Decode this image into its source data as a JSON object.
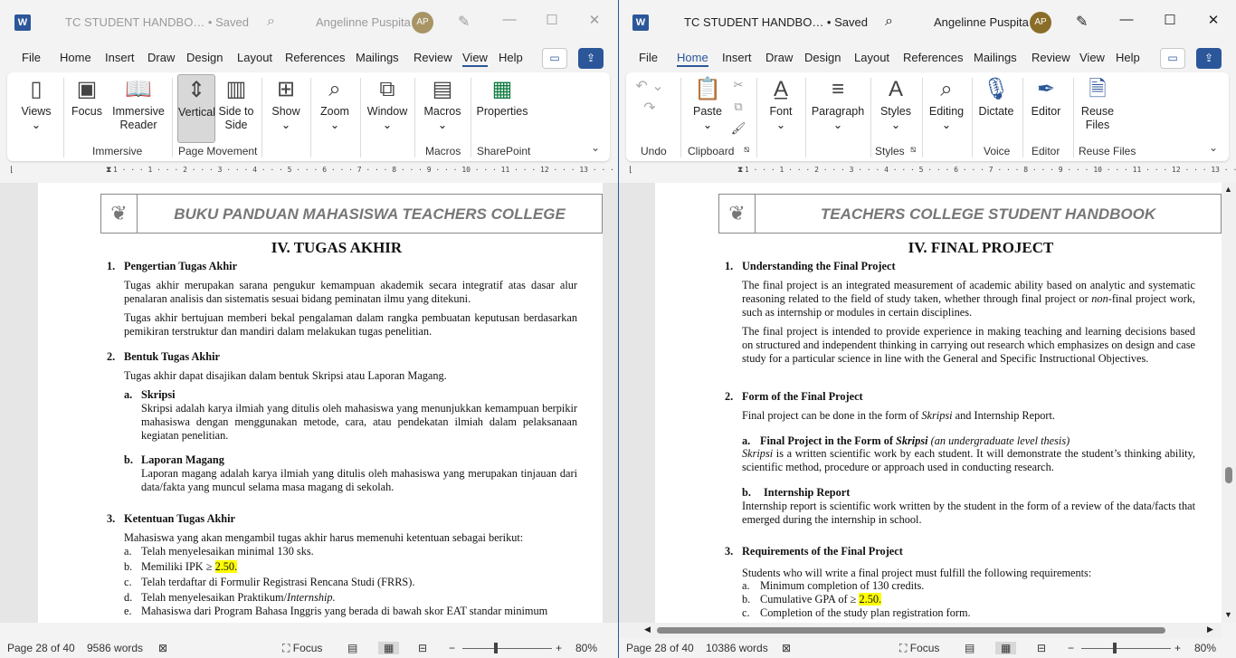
{
  "left": {
    "doc_title": "TC STUDENT HANDBO… • Saved",
    "user": "Angelinne Puspita",
    "initials": "AP",
    "menus": [
      "File",
      "Home",
      "Insert",
      "Draw",
      "Design",
      "Layout",
      "References",
      "Mailings",
      "Review",
      "View",
      "Help"
    ],
    "active_menu": "View",
    "ribbon": {
      "views": "Views",
      "focus": "Focus",
      "immersive_reader": "Immersive Reader",
      "vertical": "Vertical",
      "side_to_side": "Side to Side",
      "show": "Show",
      "zoom": "Zoom",
      "window": "Window",
      "macros": "Macros",
      "properties": "Properties",
      "groups": [
        "Immersive",
        "Page Movement",
        "Macros",
        "SharePoint"
      ]
    },
    "ruler": "1 · · · 1 · · · 2 · · · 3 · · · 4 · · · 5 · · · 6 · · · 7 · · · 8 · · · 9 · · · 10 · · · 11 · · · 12 · · · 13 · · · 14 · · · 15 · · · 16",
    "header_title": "BUKU PANDUAN MAHASISWA TEACHERS COLLEGE",
    "chapter": "IV. TUGAS AKHIR",
    "s1_num": "1.",
    "s1_title": "Pengertian Tugas Akhir",
    "s1_p1": "Tugas akhir merupakan sarana pengukur kemampuan akademik secara integratif atas dasar alur penalaran analisis dan sistematis sesuai bidang peminatan ilmu yang ditekuni.",
    "s1_p2": "Tugas akhir bertujuan memberi bekal pengalaman dalam rangka pembuatan keputusan berdasarkan pemikiran terstruktur dan mandiri dalam melakukan tugas penelitian.",
    "s2_num": "2.",
    "s2_title": "Bentuk Tugas Akhir",
    "s2_p": "Tugas akhir dapat disajikan dalam bentuk Skripsi atau Laporan Magang.",
    "s2a_label": "a.",
    "s2a_title": "Skripsi",
    "s2a_p": "Skripsi adalah karya ilmiah yang ditulis oleh mahasiswa yang menunjukkan kemampuan berpikir mahasiswa dengan menggunakan metode, cara, atau pendekatan ilmiah dalam pelaksanaan kegiatan penelitian.",
    "s2b_label": "b.",
    "s2b_title": "Laporan Magang",
    "s2b_p": "Laporan magang adalah karya ilmiah yang ditulis oleh mahasiswa yang merupakan tinjauan dari data/fakta yang muncul selama masa magang di sekolah.",
    "s3_num": "3.",
    "s3_title": "Ketentuan Tugas Akhir",
    "s3_p": "Mahasiswa yang akan mengambil tugas akhir harus memenuhi ketentuan sebagai berikut:",
    "s3_items": [
      {
        "l": "a.",
        "t": "Telah menyelesaikan minimal 130 sks."
      },
      {
        "l": "b.",
        "t": "Memiliki IPK ≥ ",
        "h": "2.50."
      },
      {
        "l": "c.",
        "t": "Telah terdaftar di Formulir Registrasi Rencana Studi (FRRS)."
      },
      {
        "l": "d.",
        "t": "Telah menyelesaikan Praktikum/",
        "it": "Internship."
      },
      {
        "l": "e.",
        "t": "Mahasiswa dari Program Bahasa Inggris yang berada di bawah skor EAT standar minimum"
      }
    ],
    "status_page": "Page 28 of 40",
    "status_words": "9586 words",
    "status_focus": "Focus",
    "zoom": "80%"
  },
  "right": {
    "doc_title": "TC STUDENT HANDBO… • Saved",
    "user": "Angelinne Puspita",
    "initials": "AP",
    "menus": [
      "File",
      "Home",
      "Insert",
      "Draw",
      "Design",
      "Layout",
      "References",
      "Mailings",
      "Review",
      "View",
      "Help"
    ],
    "active_menu": "Home",
    "ribbon": {
      "paste": "Paste",
      "font": "Font",
      "paragraph": "Paragraph",
      "styles": "Styles",
      "editing": "Editing",
      "dictate": "Dictate",
      "editor": "Editor",
      "reuse_files": "Reuse Files",
      "groups": [
        "Undo",
        "Clipboard",
        "Styles",
        "Voice",
        "Editor",
        "Reuse Files"
      ]
    },
    "ruler": "1 · · · 1 · · · 2 · · · 3 · · · 4 · · · 5 · · · 6 · · · 7 · · · 8 · · · 9 · · · 10 · · · 11 · · · 12 · · · 13 · · · 14 · · · 15 · · · 16",
    "header_title": "TEACHERS COLLEGE STUDENT HANDBOOK",
    "chapter": "IV. FINAL PROJECT",
    "s1_num": "1.",
    "s1_title": "Understanding the Final Project",
    "s1_p1_a": "The final project is an integrated measurement of academic ability based on analytic and systematic reasoning related to the field of study taken, whether through final project or ",
    "s1_p1_i": "non-",
    "s1_p1_b": "final project work, such as internship or modules in certain disciplines.",
    "s1_p2": "The final project is intended to provide experience in making teaching and learning decisions based on structured and independent thinking in carrying out research which emphasizes on design and case study for a particular science in line with the General and Specific Instructional Objectives.",
    "s2_num": "2.",
    "s2_title": "Form of the Final Project",
    "s2_p_a": "Final project can be done in the form of ",
    "s2_p_i": "Skripsi",
    "s2_p_b": " and Internship Report.",
    "s2a_label": "a.",
    "s2a_title_a": "Final Project in the Form of ",
    "s2a_title_i": "Skripsi",
    "s2a_title_note": " (an undergraduate level thesis)",
    "s2a_p_i": "Skripsi",
    "s2a_p": " is a written scientific work by each student. It will demonstrate the student’s thinking ability, scientific method, procedure or approach used in conducting research.",
    "s2b_label": "b.",
    "s2b_title": "Internship Report",
    "s2b_p": "Internship report is scientific work written by the student in the form of a review of the data/facts that emerged during the internship in school.",
    "s3_num": "3.",
    "s3_title": "Requirements of the Final Project",
    "s3_p": "Students who will write a final project must fulfill the following requirements:",
    "s3_items": [
      {
        "l": "a.",
        "t": "Minimum completion of 130 credits."
      },
      {
        "l": "b.",
        "t": "Cumulative GPA of ≥ ",
        "h": "2.50."
      },
      {
        "l": "c.",
        "t": "Completion of the study plan registration form."
      }
    ],
    "status_page": "Page 28 of 40",
    "status_words": "10386 words",
    "status_focus": "Focus",
    "zoom": "80%"
  }
}
